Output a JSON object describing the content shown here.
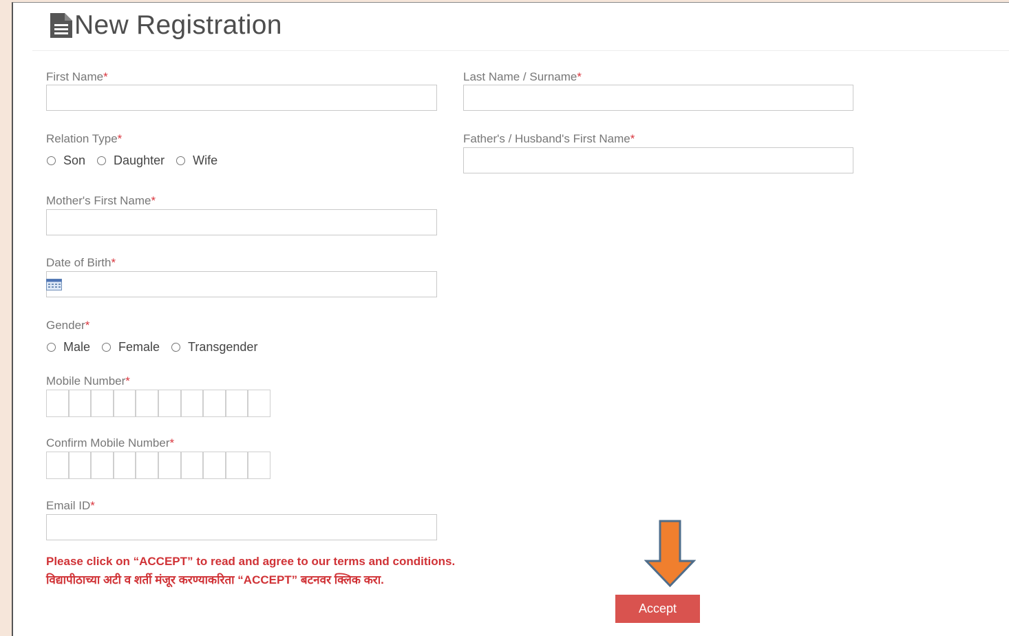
{
  "page": {
    "title": "New Registration",
    "title_icon": "document-icon"
  },
  "form": {
    "first_name": {
      "label": "First Name",
      "required_mark": "*",
      "value": ""
    },
    "last_name": {
      "label": "Last Name / Surname",
      "required_mark": "*",
      "value": ""
    },
    "relation_type": {
      "label": "Relation Type",
      "required_mark": "*",
      "options": [
        "Son",
        "Daughter",
        "Wife"
      ],
      "selected": ""
    },
    "father_husband_first_name": {
      "label": "Father's / Husband's First Name",
      "required_mark": "*",
      "value": ""
    },
    "mother_first_name": {
      "label": "Mother's First Name",
      "required_mark": "*",
      "value": ""
    },
    "date_of_birth": {
      "label": "Date of Birth",
      "required_mark": "*",
      "value": "",
      "icon": "calendar-icon"
    },
    "gender": {
      "label": "Gender",
      "required_mark": "*",
      "options": [
        "Male",
        "Female",
        "Transgender"
      ],
      "selected": ""
    },
    "mobile_number": {
      "label": "Mobile Number",
      "required_mark": "*",
      "digits": [
        "",
        "",
        "",
        "",
        "",
        "",
        "",
        "",
        "",
        ""
      ]
    },
    "confirm_mobile_number": {
      "label": "Confirm Mobile Number",
      "required_mark": "*",
      "digits": [
        "",
        "",
        "",
        "",
        "",
        "",
        "",
        "",
        "",
        ""
      ]
    },
    "email": {
      "label": "Email ID",
      "required_mark": "*",
      "value": ""
    }
  },
  "notice": {
    "english": "Please click on “ACCEPT” to read and agree to our terms and conditions.",
    "marathi": "विद्यापीठाच्या अटी व शर्ती मंजूर करण्याकरिता “ACCEPT” बटनवर क्लिक करा."
  },
  "accept_button": {
    "label": "Accept"
  },
  "colors": {
    "accent_red": "#d9534f",
    "required_red": "#d9363e",
    "arrow_orange": "#f07f2e",
    "page_bg": "#f6e6da"
  }
}
